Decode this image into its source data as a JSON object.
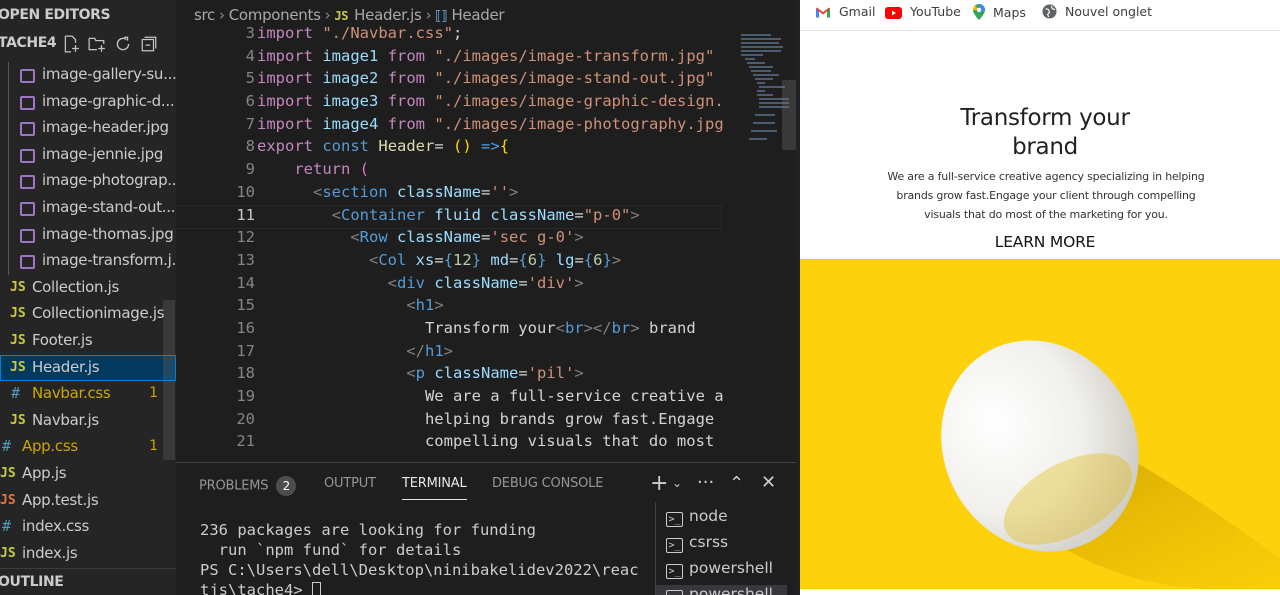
{
  "explorer": {
    "header": "OPEN EDITORS",
    "project": "TACHE4",
    "action_icons": [
      "new-file-icon",
      "new-folder-icon",
      "refresh-icon",
      "collapse-all-icon"
    ],
    "files": [
      {
        "name": "image-gallery-su...",
        "type": "image"
      },
      {
        "name": "image-graphic-d...",
        "type": "image"
      },
      {
        "name": "image-header.jpg",
        "type": "image"
      },
      {
        "name": "image-jennie.jpg",
        "type": "image"
      },
      {
        "name": "image-photograp...",
        "type": "image"
      },
      {
        "name": "image-stand-out....",
        "type": "image"
      },
      {
        "name": "image-thomas.jpg",
        "type": "image"
      },
      {
        "name": "image-transform.j...",
        "type": "image"
      },
      {
        "name": "Collection.js",
        "type": "js"
      },
      {
        "name": "Collectionimage.js",
        "type": "js"
      },
      {
        "name": "Footer.js",
        "type": "js"
      },
      {
        "name": "Header.js",
        "type": "js",
        "selected": true
      },
      {
        "name": "Navbar.css",
        "type": "css",
        "modified": true,
        "badge": "1"
      },
      {
        "name": "Navbar.js",
        "type": "js"
      },
      {
        "name": "App.css",
        "type": "css",
        "modified": true,
        "badge": "1"
      },
      {
        "name": "App.js",
        "type": "js"
      },
      {
        "name": "App.test.js",
        "type": "js"
      },
      {
        "name": "index.css",
        "type": "css"
      },
      {
        "name": "index.js",
        "type": "js"
      }
    ],
    "outline": "OUTLINE"
  },
  "editor": {
    "breadcrumb": {
      "folder": "src",
      "subfolder": "Components",
      "file": "Header.js",
      "symbol": "Header"
    },
    "line_numbers": [
      "3",
      "4",
      "5",
      "6",
      "7",
      "8",
      "9",
      "10",
      "11",
      "12",
      "13",
      "14",
      "15",
      "16",
      "17",
      "18",
      "19",
      "20",
      "21"
    ],
    "current_line": "11"
  },
  "panel": {
    "tabs": [
      "PROBLEMS",
      "OUTPUT",
      "TERMINAL",
      "DEBUG CONSOLE"
    ],
    "problems_count": "2",
    "active_tab": "TERMINAL",
    "terminal_lines": [
      "236 packages are looking for funding",
      "  run `npm fund` for details",
      "PS C:\\Users\\dell\\Desktop\\ninibakelidev2022\\reac",
      "tjs\\tache4> "
    ],
    "terminals": [
      "node",
      "csrss",
      "powershell",
      "powershell"
    ]
  },
  "browser": {
    "bookmarks": [
      "Gmail",
      "YouTube",
      "Maps",
      "Nouvel onglet"
    ],
    "hero": {
      "title_line1": "Transform your",
      "title_line2": "brand",
      "description": "We are a full-service creative agency specializing in helping brands grow fast.Engage your client through compelling visuals that do most of the marketing for you.",
      "cta": "LEARN MORE"
    }
  }
}
